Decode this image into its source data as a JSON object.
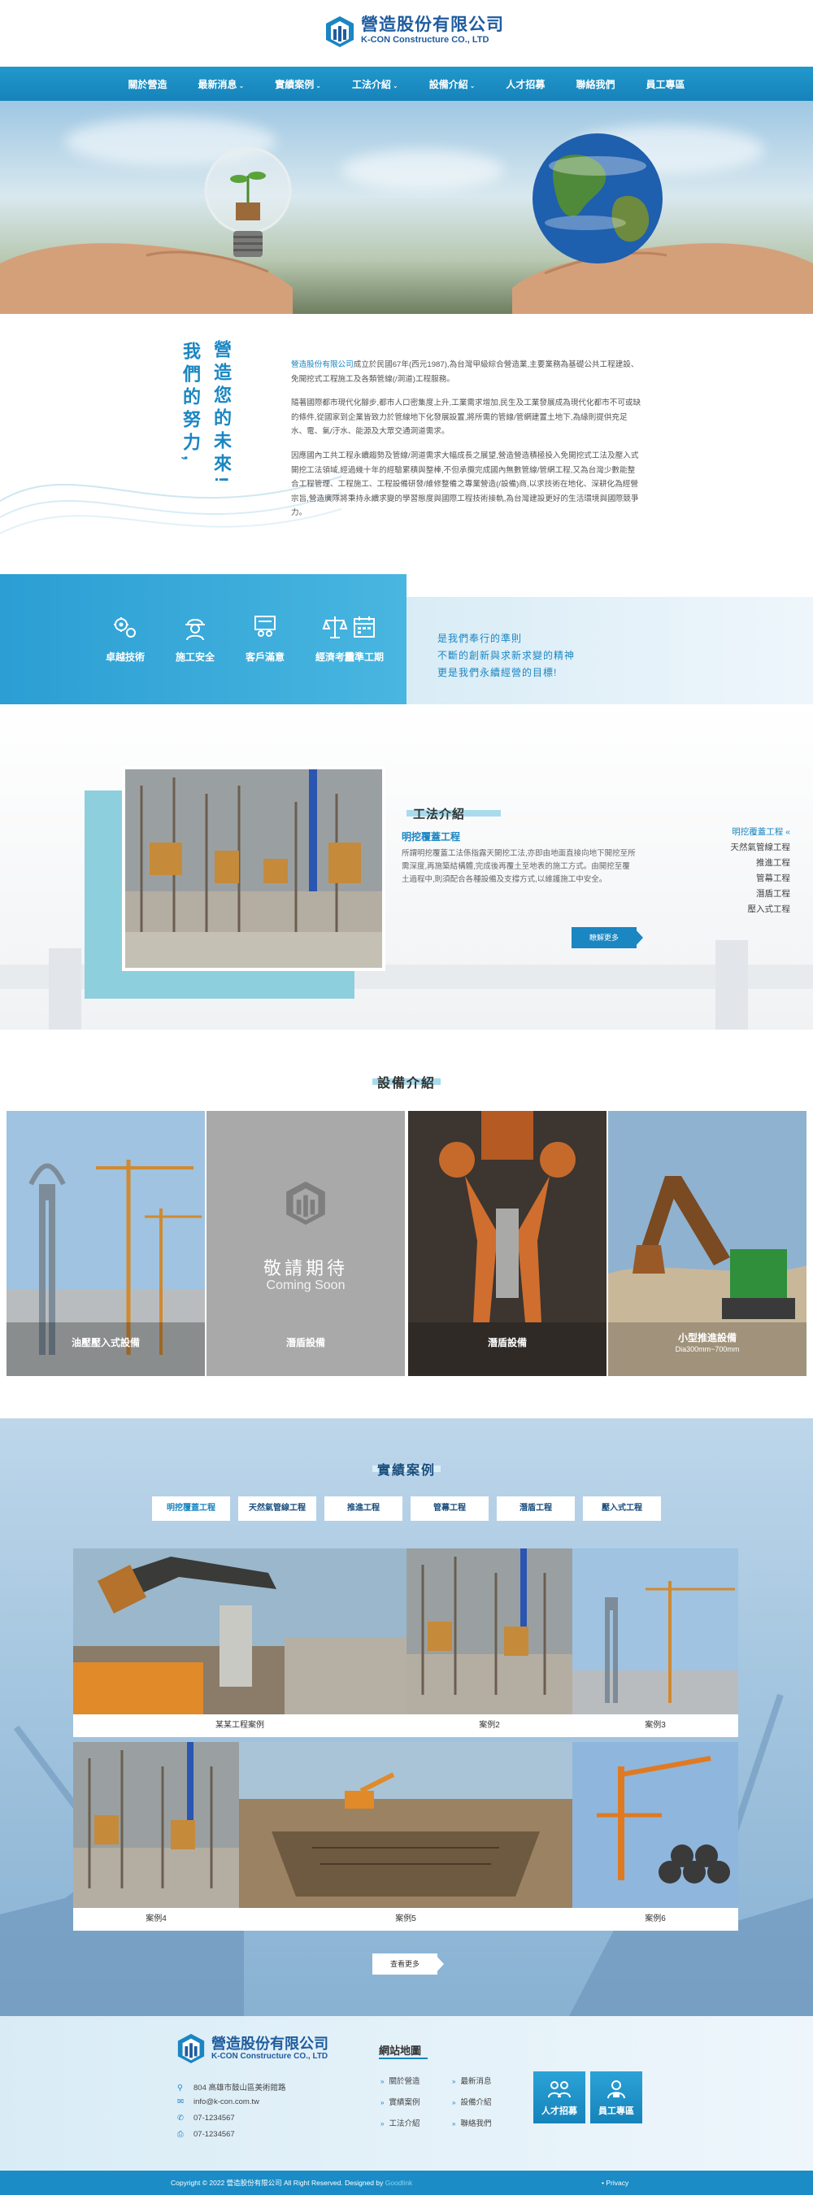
{
  "brand": {
    "name": "營造股份有限公司",
    "sub": "K-CON Constructure CO., LTD"
  },
  "nav": {
    "items": [
      "關於營造",
      "最新消息",
      "實績案例",
      "工法介紹",
      "設備介紹",
      "人才招募",
      "聯絡我們",
      "員工專區"
    ]
  },
  "intro": {
    "heading_right": "營造您的未來!",
    "heading_left": "我們的努力,",
    "company_link": "營造股份有限公司",
    "p1": "成立於民國67年(西元1987),為台灣甲級綜合營造業,主要業務為基礎公共工程建設、免開挖式工程施工及各類管線(/洞道)工程服務。",
    "p2": "隨著國際都市現代化腳步,都市人口密集度上升,工業需求增加,民生及工業發展成為現代化都市不可或缺的條件,從國家到企業皆致力於管線地下化發展設置,將所需的管線/管網建置土地下,為緣則提供充足水、電、氣/汙水、能源及大眾交通洞道需求。",
    "p3": "因應國內工共工程永續趨勢及管線/洞道需求大幅成長之展望,營造營造積極投入免開挖式工法及壓入式開挖工法領域,經過幾十年的經驗累積與整棒,不但承攬完成國內無數管線/管網工程,又為台灣少數能整合工程管理、工程施工、工程設備研發/維修整備之專業營造(/設備)商,以求技術在地化、深耕化為經營宗旨,營造廣隊將秉持永續求變的學習態度與國際工程技術接軌,為台灣建設更好的生活環境與國際競爭力。"
  },
  "values": {
    "items": [
      "卓越技術",
      "施工安全",
      "客戶滿意",
      "經濟考量",
      "精準工期"
    ],
    "motto": [
      "是我們奉行的準則",
      "不斷的創新與求新求變的精神",
      "更是我們永續經營的目標!"
    ]
  },
  "method": {
    "title": "工法介紹",
    "subtitle": "明挖覆蓋工程",
    "desc": "所謂明挖覆蓋工法係指露天開挖工法,亦即由地面直接向地下開挖至所需深度,再施築結構體,完成後再覆土至地表的施工方式。由開挖至覆土過程中,則須配合各種設備及支撐方式,以維護施工中安全。",
    "more": "瞭解更多",
    "side": [
      "明挖覆蓋工程",
      "天然氣管線工程",
      "推進工程",
      "管幕工程",
      "潛盾工程",
      "壓入式工程"
    ]
  },
  "equipment": {
    "title": "設備介紹",
    "coming_big": "敬請期待",
    "coming_en": "Coming Soon",
    "items": [
      {
        "label": "油壓壓入式設備",
        "sub": ""
      },
      {
        "label": "潛盾設備",
        "sub": ""
      },
      {
        "label": "潛盾設備",
        "sub": ""
      },
      {
        "label": "小型推進設備",
        "sub": "Dia300mm~700mm"
      }
    ]
  },
  "cases": {
    "title": "實績案例",
    "tabs": [
      "明挖覆蓋工程",
      "天然氣管線工程",
      "推進工程",
      "管幕工程",
      "潛盾工程",
      "壓入式工程"
    ],
    "items": [
      "某某工程案例",
      "案例2",
      "案例3",
      "案例4",
      "案例5",
      "案例6"
    ],
    "more": "查看更多"
  },
  "footer": {
    "name": "營造股份有限公司",
    "sub": "K-CON Constructure CO., LTD",
    "address": "804 高雄市鼓山區美術館路",
    "email": "info@k-con.com.tw",
    "phone": "07-1234567",
    "fax": "07-1234567",
    "sitemap_title": "網站地圖",
    "sitemap": [
      "關於營造",
      "最新消息",
      "實績案例",
      "設備介紹",
      "工法介紹",
      "聯絡我們"
    ],
    "btn_recruit": "人才招募",
    "btn_staff": "員工專區",
    "copyright": "Copyright © 2022 營造股份有限公司 All Right Reserved. Designed by",
    "designer": "Goodlink",
    "privacy": "• Privacy"
  },
  "colors": {
    "primary": "#1a86c2",
    "nav": "#1b8cc6",
    "brand": "#1f5c9e"
  }
}
